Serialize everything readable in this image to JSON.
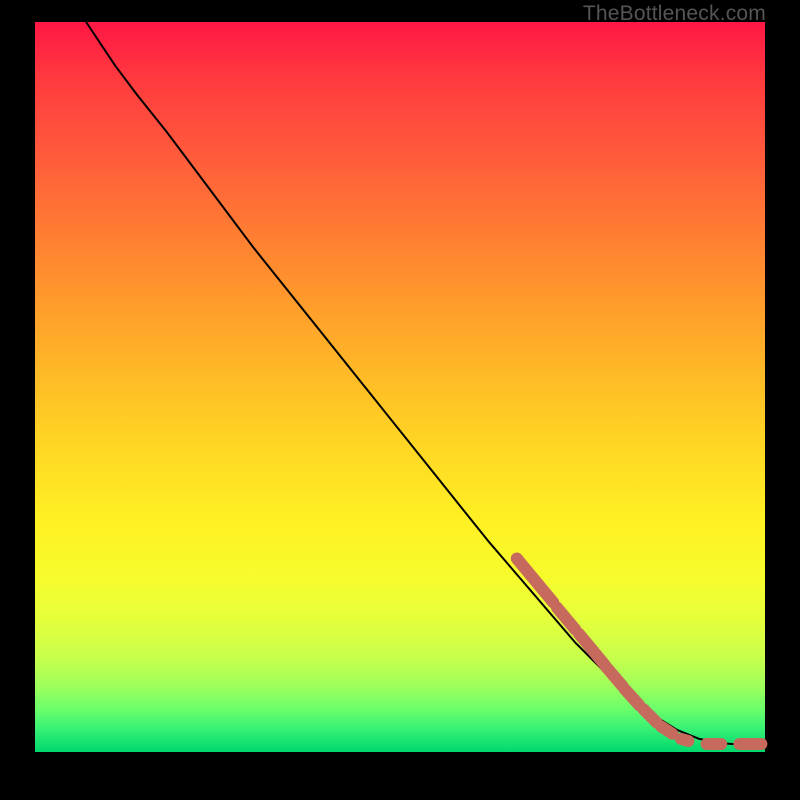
{
  "watermark": "TheBottleneck.com",
  "chart_data": {
    "type": "line",
    "title": "",
    "xlabel": "",
    "ylabel": "",
    "xlim": [
      0,
      100
    ],
    "ylim": [
      0,
      100
    ],
    "curve": {
      "name": "bottleneck-curve",
      "x": [
        7,
        9,
        11,
        14,
        18,
        24,
        30,
        38,
        46,
        54,
        62,
        68,
        74,
        80,
        84,
        88,
        91,
        94,
        97,
        100
      ],
      "y": [
        100,
        97,
        94,
        90,
        85,
        77,
        69,
        59,
        49,
        39,
        29,
        22,
        15,
        9,
        5.5,
        3,
        1.8,
        1.2,
        1,
        1
      ]
    },
    "highlight_segments": [
      {
        "x0": 66,
        "y0": 26.5,
        "x1": 71,
        "y1": 20.5
      },
      {
        "x0": 71.5,
        "y0": 19.8,
        "x1": 74,
        "y1": 16.8
      },
      {
        "x0": 74.5,
        "y0": 16.2,
        "x1": 78,
        "y1": 12.0
      },
      {
        "x0": 78.2,
        "y0": 11.7,
        "x1": 80.5,
        "y1": 9.0
      },
      {
        "x0": 80.8,
        "y0": 8.6,
        "x1": 82.8,
        "y1": 6.4
      },
      {
        "x0": 83.3,
        "y0": 5.9,
        "x1": 85.2,
        "y1": 4.0
      },
      {
        "x0": 85.8,
        "y0": 3.5,
        "x1": 87.3,
        "y1": 2.5
      },
      {
        "x0": 88.5,
        "y0": 1.8,
        "x1": 89.5,
        "y1": 1.5
      },
      {
        "x0": 92.0,
        "y0": 1.1,
        "x1": 94.0,
        "y1": 1.1
      },
      {
        "x0": 96.5,
        "y0": 1.1,
        "x1": 99.5,
        "y1": 1.1
      }
    ],
    "colors": {
      "curve": "#000000",
      "highlight": "#c66a5d"
    }
  }
}
